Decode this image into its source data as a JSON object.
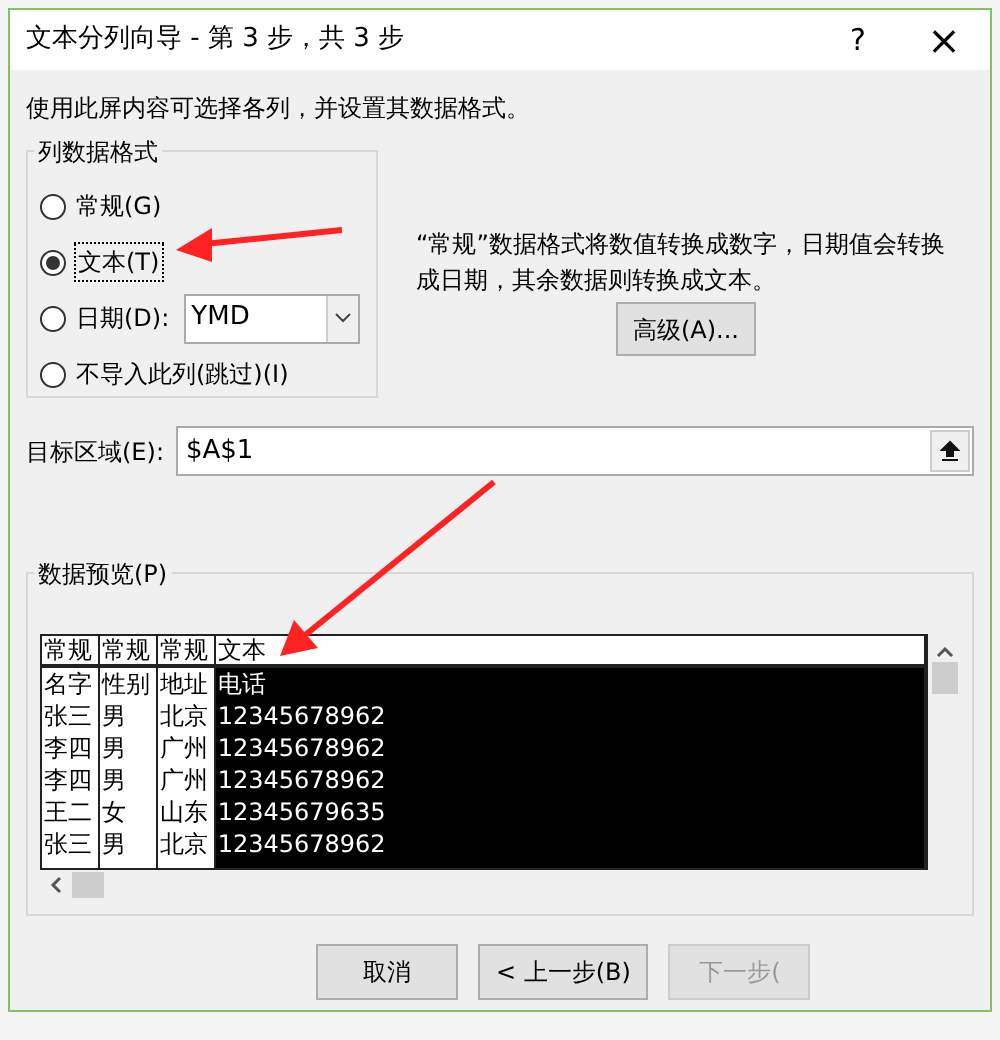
{
  "window": {
    "title": "文本分列向导 - 第 3 步，共 3 步",
    "help": "?",
    "close": "×"
  },
  "instruction": "使用此屏内容可选择各列，并设置其数据格式。",
  "column_format": {
    "title": "列数据格式",
    "options": [
      {
        "label": "常规(G)",
        "selected": false
      },
      {
        "label": "文本(T)",
        "selected": true
      },
      {
        "label": "日期(D):",
        "selected": false,
        "dropdown": "YMD"
      },
      {
        "label": "不导入此列(跳过)(I)",
        "selected": false
      }
    ],
    "description": "“常规”数据格式将数值转换成数字，日期值会转换成日期，其余数据则转换成文本。",
    "advanced_button": "高级(A)..."
  },
  "destination": {
    "label": "目标区域(E):",
    "value": "$A$1"
  },
  "preview": {
    "title": "数据预览(P)",
    "columns": [
      {
        "format": "常规",
        "selected": false
      },
      {
        "format": "常规",
        "selected": false
      },
      {
        "format": "常规",
        "selected": false
      },
      {
        "format": "文本",
        "selected": true
      }
    ],
    "rows": [
      [
        "名字",
        "性别",
        "地址",
        "电话"
      ],
      [
        "张三",
        "男",
        "北京",
        "12345678962"
      ],
      [
        "李四",
        "男",
        "广州",
        "12345678962"
      ],
      [
        "李四",
        "男",
        "广州",
        "12345678962"
      ],
      [
        "王二",
        "女",
        "山东",
        "12345679635"
      ],
      [
        "张三",
        "男",
        "北京",
        "12345678962"
      ]
    ]
  },
  "buttons": [
    {
      "label": "取消",
      "disabled": false
    },
    {
      "label": "< 上一步(B)",
      "disabled": false
    },
    {
      "label": "下一步(",
      "disabled": true
    }
  ]
}
